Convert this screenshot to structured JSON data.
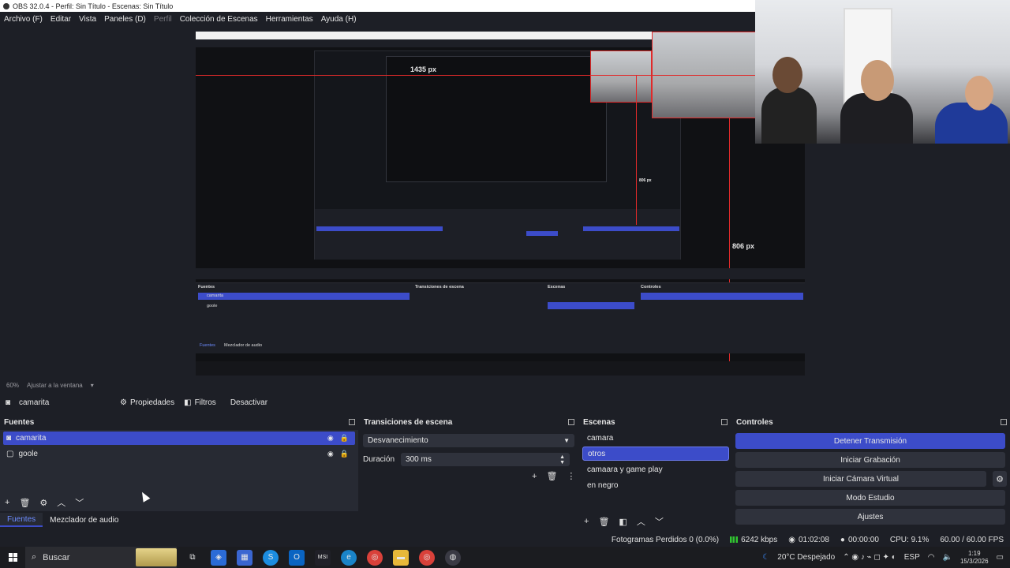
{
  "window": {
    "title": "OBS 32.0.4 - Perfil: Sin Título - Escenas: Sin Título"
  },
  "menu": [
    "Archivo (F)",
    "Editar",
    "Vista",
    "Paneles (D)",
    "Perfil",
    "Colección de Escenas",
    "Herramientas",
    "Ayuda (H)"
  ],
  "preview": {
    "px_label_top": "1435 px",
    "px_label_right": "806 px",
    "px_label_mid": "806 px",
    "inner_sources": [
      "camarita",
      "goole"
    ],
    "inner_tabs": [
      "Fuentes",
      "Mezclador de audio"
    ],
    "inner_scene_header": "Escenas",
    "inner_controls_header": "Controles",
    "inner_transitions_header": "Transiciones de escena",
    "inner_sources_header": "Fuentes"
  },
  "zoom": {
    "percent": "60%",
    "fit_label": "Ajustar a la ventana"
  },
  "source_toolbar": {
    "selected_source": "camarita",
    "properties": "Propiedades",
    "filters": "Filtros",
    "deactivate": "Desactivar"
  },
  "sources": {
    "title": "Fuentes",
    "items": [
      {
        "name": "camarita",
        "selected": true
      },
      {
        "name": "goole",
        "selected": false
      }
    ],
    "tabs": [
      "Fuentes",
      "Mezclador de audio"
    ]
  },
  "transitions": {
    "title": "Transiciones de escena",
    "current": "Desvanecimiento",
    "duration_label": "Duración",
    "duration_value": "300 ms"
  },
  "scenes": {
    "title": "Escenas",
    "items": [
      {
        "name": "camara",
        "selected": false
      },
      {
        "name": "otros",
        "selected": true
      },
      {
        "name": "camaara y game play",
        "selected": false
      },
      {
        "name": "en negro",
        "selected": false
      }
    ]
  },
  "controls": {
    "title": "Controles",
    "stop_stream": "Detener Transmisión",
    "start_recording": "Iniciar Grabación",
    "start_virtual_cam": "Iniciar Cámara Virtual",
    "studio_mode": "Modo Estudio",
    "settings": "Ajustes"
  },
  "status": {
    "dropped_frames": "Fotogramas Perdidos 0 (0.0%)",
    "bitrate": "6242 kbps",
    "stream_time": "01:02:08",
    "rec_time": "00:00:00",
    "cpu": "CPU: 9.1%",
    "fps": "60.00 / 60.00 FPS"
  },
  "taskbar": {
    "search_placeholder": "Buscar",
    "weather": "20°C  Despejado",
    "language": "ESP",
    "time": "1:19",
    "date": "15/3/2026"
  },
  "colors": {
    "accent": "#3c4cc9",
    "background": "#1d1f26",
    "panel": "#272a33",
    "red_guides": "#e02a2a"
  }
}
